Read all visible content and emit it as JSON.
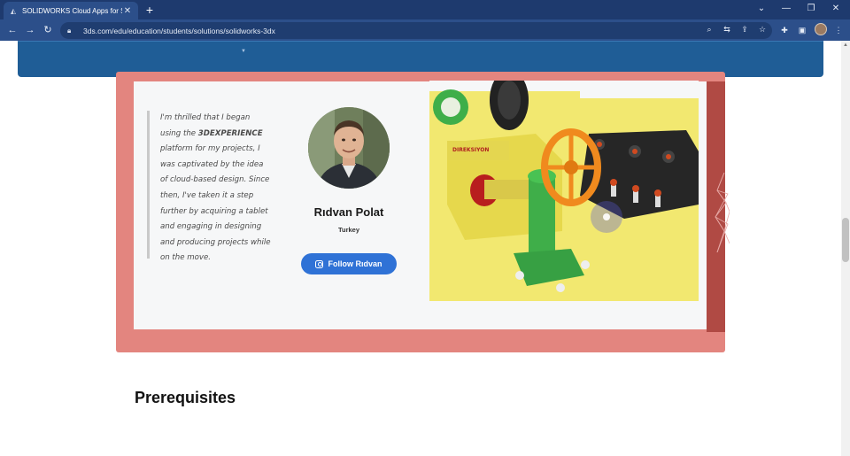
{
  "browser": {
    "tab_title": "SOLIDWORKS Cloud Apps for St",
    "new_tab": "+",
    "url": "3ds.com/edu/education/students/solutions/solidworks-3dx",
    "icons": [
      "back-icon",
      "forward-icon",
      "reload-icon",
      "lock-icon",
      "search-icon",
      "translate-icon",
      "share-icon",
      "bookmark-star-icon",
      "extensions-icon",
      "sidepanel-icon",
      "profile-avatar",
      "menu-icon"
    ]
  },
  "testimonial": {
    "quote_parts": [
      "I'm thrilled that I began using the ",
      "3DEXPERIENCE",
      " platform for my projects, I was captivated by the idea of cloud-based design. Since then, I've taken it a step further by acquiring a tablet and engaging in designing and producing projects while on the move."
    ],
    "name": "Rıdvan Polat",
    "country": "Turkey",
    "follow_label": "Follow Rıdvan"
  },
  "section": {
    "heading": "Prerequisites"
  },
  "colors": {
    "browser_dark": "#1e3a6e",
    "browser_toolbar": "#2c4f8a",
    "banner_blue": "#1f5d96",
    "card_frame": "#e3857f",
    "card_side": "#b04a44",
    "follow_button": "#2f72d6",
    "render_yellow": "#f2e870"
  }
}
